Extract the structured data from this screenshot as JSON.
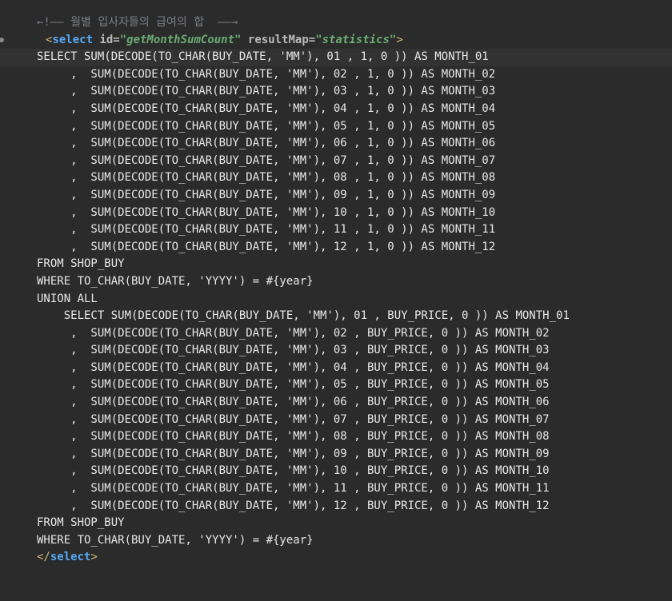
{
  "editor": {
    "comment_line": "←!—— 월별 입사자들의 급여의 합  ——→",
    "open_tag": {
      "lt": "<",
      "name": "select",
      "attr1_name": "id=",
      "attr1_value": "\"getMonthSumCount\"",
      "attr2_name": "resultMap=",
      "attr2_value": "\"statistics\"",
      "gt": ">"
    },
    "sql_lines": [
      "SELECT SUM(DECODE(TO_CHAR(BUY_DATE, 'MM'), 01 , 1, 0 )) AS MONTH_01",
      "     ,  SUM(DECODE(TO_CHAR(BUY_DATE, 'MM'), 02 , 1, 0 )) AS MONTH_02",
      "     ,  SUM(DECODE(TO_CHAR(BUY_DATE, 'MM'), 03 , 1, 0 )) AS MONTH_03",
      "     ,  SUM(DECODE(TO_CHAR(BUY_DATE, 'MM'), 04 , 1, 0 )) AS MONTH_04",
      "     ,  SUM(DECODE(TO_CHAR(BUY_DATE, 'MM'), 05 , 1, 0 )) AS MONTH_05",
      "     ,  SUM(DECODE(TO_CHAR(BUY_DATE, 'MM'), 06 , 1, 0 )) AS MONTH_06",
      "     ,  SUM(DECODE(TO_CHAR(BUY_DATE, 'MM'), 07 , 1, 0 )) AS MONTH_07",
      "     ,  SUM(DECODE(TO_CHAR(BUY_DATE, 'MM'), 08 , 1, 0 )) AS MONTH_08",
      "     ,  SUM(DECODE(TO_CHAR(BUY_DATE, 'MM'), 09 , 1, 0 )) AS MONTH_09",
      "     ,  SUM(DECODE(TO_CHAR(BUY_DATE, 'MM'), 10 , 1, 0 )) AS MONTH_10",
      "     ,  SUM(DECODE(TO_CHAR(BUY_DATE, 'MM'), 11 , 1, 0 )) AS MONTH_11",
      "     ,  SUM(DECODE(TO_CHAR(BUY_DATE, 'MM'), 12 , 1, 0 )) AS MONTH_12",
      "FROM SHOP_BUY",
      "WHERE TO_CHAR(BUY_DATE, 'YYYY') = #{year}",
      "UNION ALL",
      "    SELECT SUM(DECODE(TO_CHAR(BUY_DATE, 'MM'), 01 , BUY_PRICE, 0 )) AS MONTH_01",
      "     ,  SUM(DECODE(TO_CHAR(BUY_DATE, 'MM'), 02 , BUY_PRICE, 0 )) AS MONTH_02",
      "     ,  SUM(DECODE(TO_CHAR(BUY_DATE, 'MM'), 03 , BUY_PRICE, 0 )) AS MONTH_03",
      "     ,  SUM(DECODE(TO_CHAR(BUY_DATE, 'MM'), 04 , BUY_PRICE, 0 )) AS MONTH_04",
      "     ,  SUM(DECODE(TO_CHAR(BUY_DATE, 'MM'), 05 , BUY_PRICE, 0 )) AS MONTH_05",
      "     ,  SUM(DECODE(TO_CHAR(BUY_DATE, 'MM'), 06 , BUY_PRICE, 0 )) AS MONTH_06",
      "     ,  SUM(DECODE(TO_CHAR(BUY_DATE, 'MM'), 07 , BUY_PRICE, 0 )) AS MONTH_07",
      "     ,  SUM(DECODE(TO_CHAR(BUY_DATE, 'MM'), 08 , BUY_PRICE, 0 )) AS MONTH_08",
      "     ,  SUM(DECODE(TO_CHAR(BUY_DATE, 'MM'), 09 , BUY_PRICE, 0 )) AS MONTH_09",
      "     ,  SUM(DECODE(TO_CHAR(BUY_DATE, 'MM'), 10 , BUY_PRICE, 0 )) AS MONTH_10",
      "     ,  SUM(DECODE(TO_CHAR(BUY_DATE, 'MM'), 11 , BUY_PRICE, 0 )) AS MONTH_11",
      "     ,  SUM(DECODE(TO_CHAR(BUY_DATE, 'MM'), 12 , BUY_PRICE, 0 )) AS MONTH_12",
      "FROM SHOP_BUY",
      "WHERE TO_CHAR(BUY_DATE, 'YYYY') = #{year}"
    ],
    "close_tag": {
      "lt": "</",
      "name": "select",
      "gt": ">"
    }
  },
  "colors": {
    "background": "#2b2b2b",
    "current_line": "#323232",
    "comment": "#7a7e85",
    "tag_name": "#56a8f5",
    "attr_value": "#6aab73"
  }
}
